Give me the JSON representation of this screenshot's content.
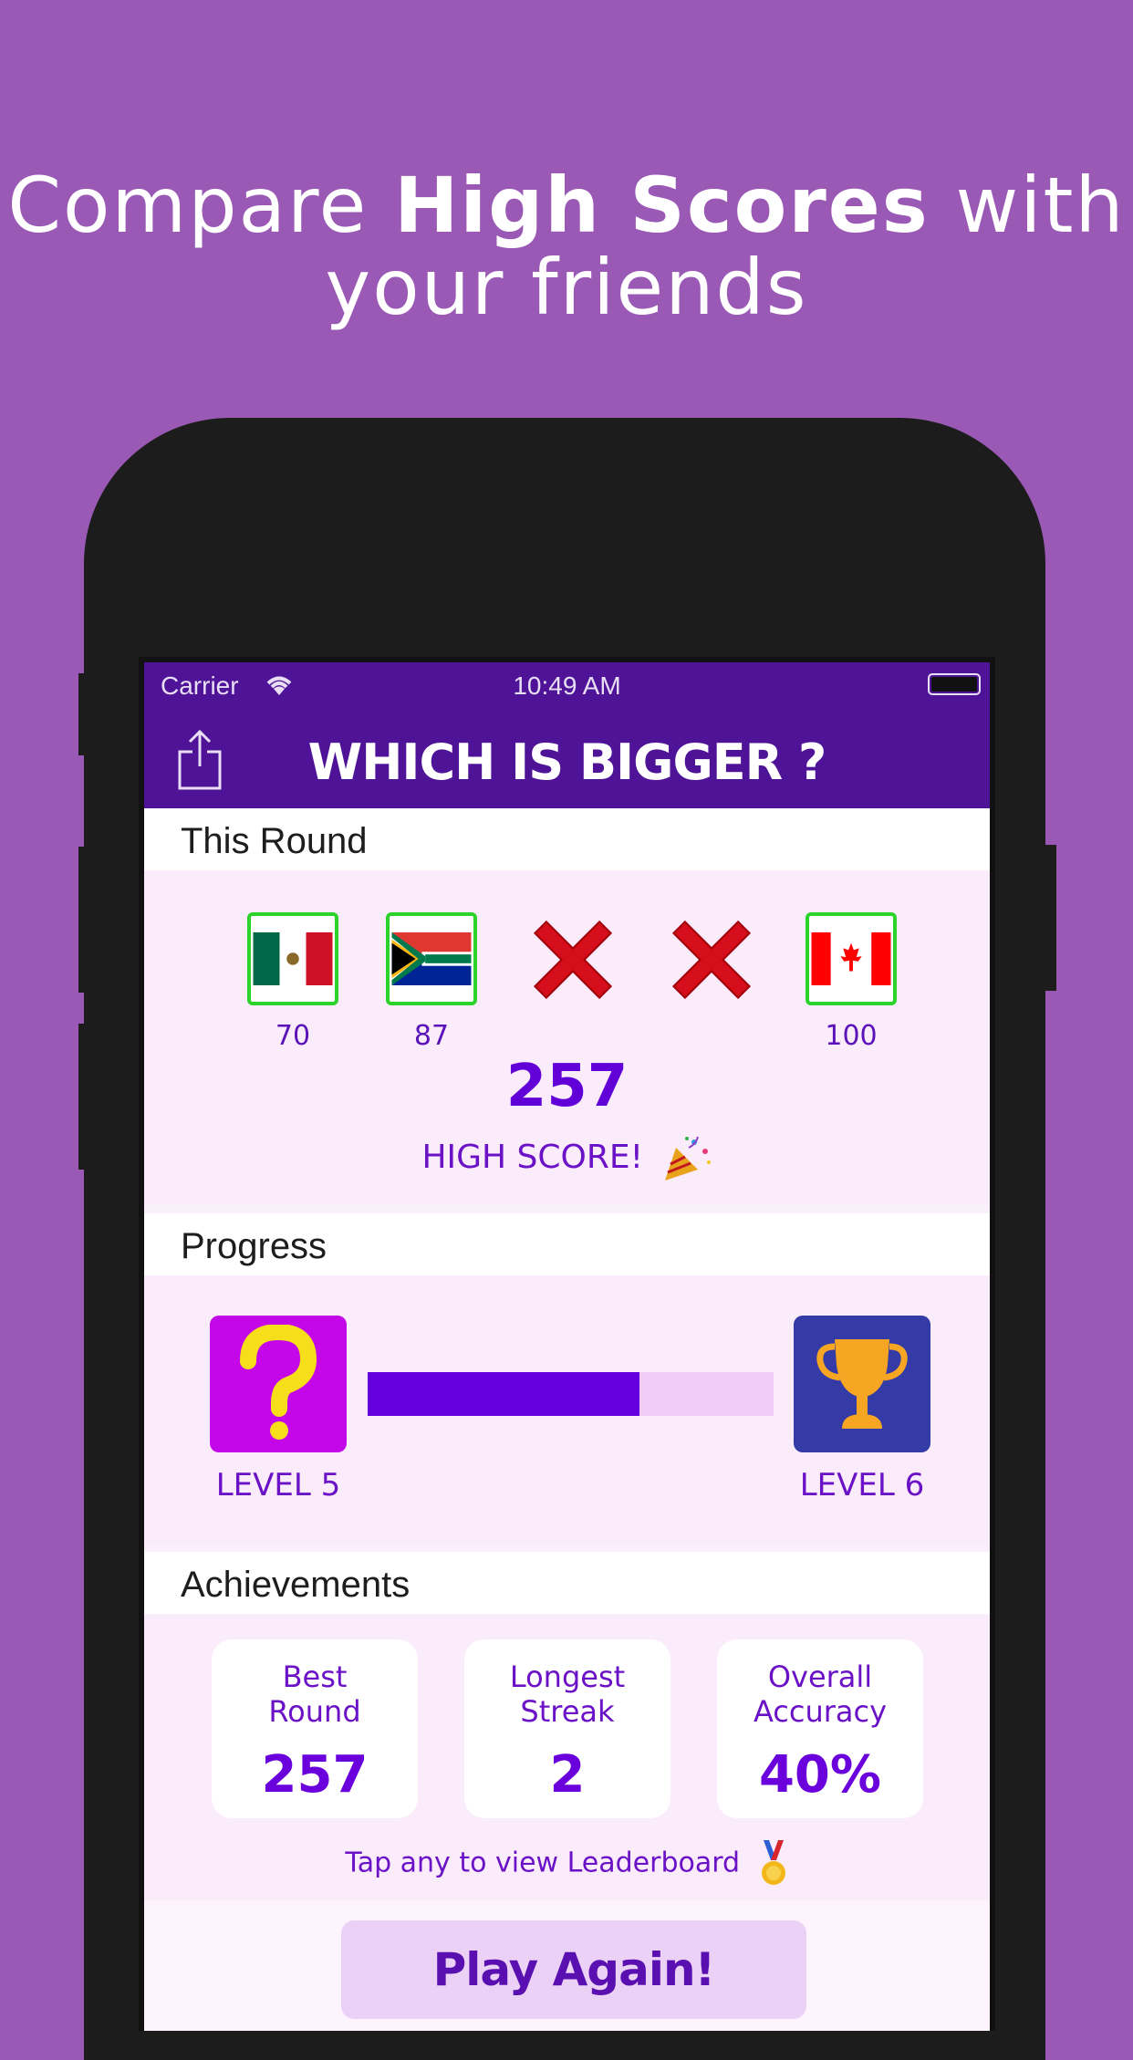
{
  "headline": {
    "pre": "Compare ",
    "bold": "High Scores",
    "post": " with",
    "line2": "your friends"
  },
  "status_bar": {
    "carrier": "Carrier",
    "time": "10:49 AM"
  },
  "nav": {
    "title": "WHICH IS BIGGER ?"
  },
  "this_round": {
    "header": "This Round",
    "slots": [
      {
        "result": "correct",
        "flag": "mexico-flag-icon",
        "value": "70"
      },
      {
        "result": "correct",
        "flag": "south-africa-flag-icon",
        "value": "87"
      },
      {
        "result": "wrong",
        "flag": "red-x-icon",
        "value": ""
      },
      {
        "result": "wrong",
        "flag": "red-x-icon",
        "value": ""
      },
      {
        "result": "correct",
        "flag": "canada-flag-icon",
        "value": "100"
      }
    ],
    "score": "257",
    "high_score_label": "HIGH SCORE!"
  },
  "progress": {
    "header": "Progress",
    "current_level": "LEVEL 5",
    "next_level": "LEVEL 6",
    "fill_fraction": 0.67
  },
  "achievements": {
    "header": "Achievements",
    "cards": [
      {
        "label_line1": "Best",
        "label_line2": "Round",
        "value": "257"
      },
      {
        "label_line1": "Longest",
        "label_line2": "Streak",
        "value": "2"
      },
      {
        "label_line1": "Overall",
        "label_line2": "Accuracy",
        "value": "40%"
      }
    ],
    "hint": "Tap any to view Leaderboard"
  },
  "play_again_label": "Play Again!",
  "colors": {
    "background": "#9a59b5",
    "nav": "#4e1397",
    "accent": "#6700de",
    "correct_border": "#2bd32b",
    "level5_tile": "#c307e8",
    "level6_tile": "#343aa6",
    "trophy": "#f6a623"
  }
}
